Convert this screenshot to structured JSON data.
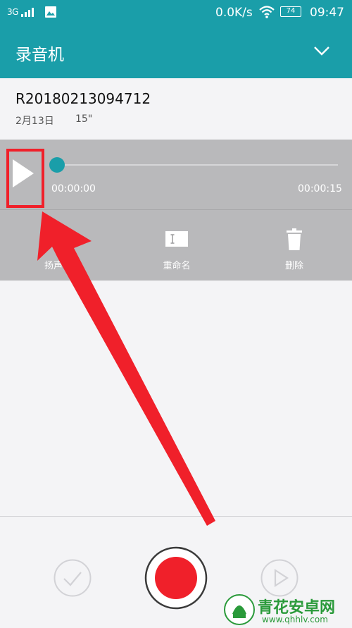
{
  "status_bar": {
    "signal": "3G",
    "speed": "0.0K/s",
    "battery": "74",
    "time": "09:47"
  },
  "app": {
    "title": "录音机"
  },
  "recording": {
    "name": "R20180213094712",
    "date": "2月13日",
    "duration": "15\""
  },
  "player": {
    "elapsed": "00:00:00",
    "total": "00:00:15",
    "progress": 0
  },
  "actions": {
    "speaker": "扬声",
    "rename": "重命名",
    "delete": "删除"
  },
  "watermark": {
    "brand": "青花安卓网",
    "url": "www.qhhlv.com"
  },
  "colors": {
    "primary": "#1a9ea9",
    "record": "#f0202a",
    "panel": "#b9b9bb"
  }
}
